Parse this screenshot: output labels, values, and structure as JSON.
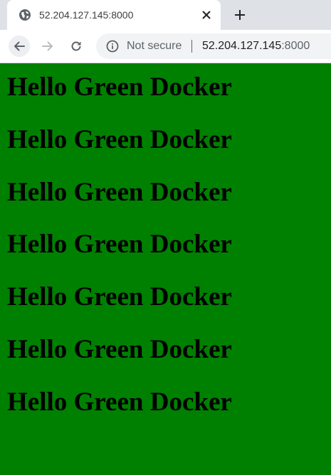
{
  "tab": {
    "title": "52.204.127.145:8000",
    "favicon": "globe-icon",
    "close_icon": "close-icon",
    "new_tab_icon": "plus-icon"
  },
  "toolbar": {
    "back_icon": "back-arrow-icon",
    "forward_icon": "forward-arrow-icon",
    "reload_icon": "reload-icon",
    "security_icon": "info-icon",
    "security_label": "Not secure",
    "url_host": "52.204.127.145",
    "url_port": ":8000"
  },
  "page": {
    "background_color": "#008000",
    "headings": [
      "Hello Green Docker",
      "Hello Green Docker",
      "Hello Green Docker",
      "Hello Green Docker",
      "Hello Green Docker",
      "Hello Green Docker",
      "Hello Green Docker"
    ]
  }
}
